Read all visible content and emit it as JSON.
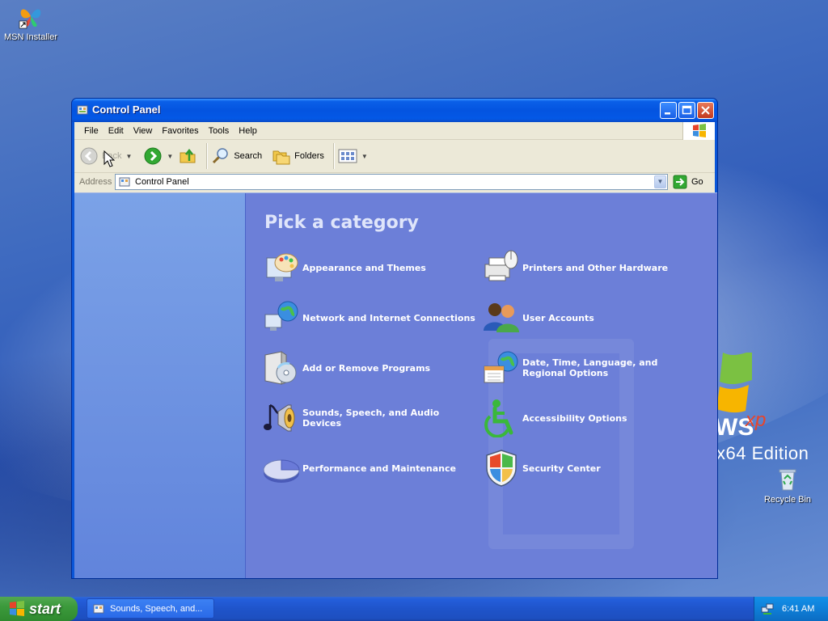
{
  "desktop": {
    "icons": [
      {
        "label": "MSN Installer",
        "icon": "msn-butterfly-icon"
      },
      {
        "label": "Recycle Bin",
        "icon": "recycle-bin-icon"
      }
    ],
    "brand": {
      "ws": "WS",
      "xp": "xp",
      "edition": "x64 Edition"
    }
  },
  "window": {
    "title": "Control Panel",
    "menu": [
      "File",
      "Edit",
      "View",
      "Favorites",
      "Tools",
      "Help"
    ],
    "toolbar": {
      "back_label": "Back",
      "search_label": "Search",
      "folders_label": "Folders"
    },
    "address": {
      "label": "Address",
      "value": "Control Panel",
      "go_label": "Go"
    }
  },
  "main": {
    "heading": "Pick a category",
    "categories": [
      {
        "label": "Appearance and Themes",
        "icon": "appearance-themes-icon"
      },
      {
        "label": "Printers and Other Hardware",
        "icon": "printer-hardware-icon"
      },
      {
        "label": "Network and Internet Connections",
        "icon": "network-globe-icon"
      },
      {
        "label": "User Accounts",
        "icon": "user-accounts-icon"
      },
      {
        "label": "Add or Remove Programs",
        "icon": "add-remove-programs-icon"
      },
      {
        "label": "Date, Time, Language, and Regional Options",
        "icon": "date-time-globe-icon"
      },
      {
        "label": "Sounds, Speech, and Audio Devices",
        "icon": "sound-speaker-icon"
      },
      {
        "label": "Accessibility Options",
        "icon": "accessibility-icon"
      },
      {
        "label": "Performance and Maintenance",
        "icon": "performance-chart-icon"
      },
      {
        "label": "Security Center",
        "icon": "security-shield-icon"
      }
    ]
  },
  "taskbar": {
    "start_label": "start",
    "task_label": "Sounds, Speech, and...",
    "clock": "6:41 AM"
  }
}
